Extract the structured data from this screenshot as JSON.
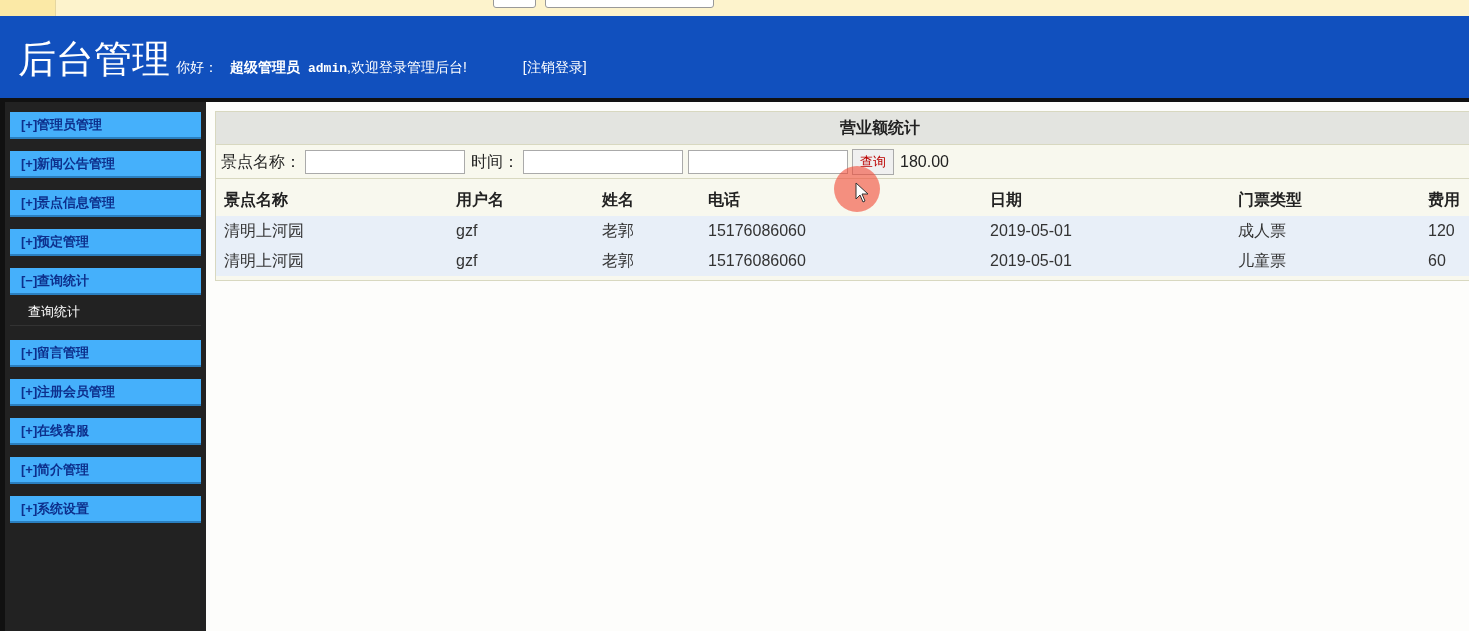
{
  "header": {
    "title": "后台管理",
    "greeting": "你好：",
    "role": "超级管理员",
    "username": "admin",
    "welcome": ",欢迎登录管理后台!",
    "logout": "[注销登录]"
  },
  "sidebar": {
    "items": [
      {
        "label": "[+]管理员管理"
      },
      {
        "label": "[+]新闻公告管理"
      },
      {
        "label": "[+]景点信息管理"
      },
      {
        "label": "[+]预定管理"
      },
      {
        "label": "[−]查询统计",
        "children": [
          {
            "label": "查询统计"
          }
        ]
      },
      {
        "label": "[+]留言管理"
      },
      {
        "label": "[+]注册会员管理"
      },
      {
        "label": "[+]在线客服"
      },
      {
        "label": "[+]简介管理"
      },
      {
        "label": "[+]系统设置"
      }
    ]
  },
  "panel": {
    "title": "营业额统计",
    "search": {
      "name_label": "景点名称：",
      "time_label": "时间：",
      "button": "查询",
      "total": "180.00"
    },
    "table": {
      "columns": [
        "景点名称",
        "用户名",
        "姓名",
        "电话",
        "日期",
        "门票类型",
        "费用"
      ],
      "rows": [
        [
          "清明上河园",
          "gzf",
          "老郭",
          "15176086060",
          "2019-05-01",
          "成人票",
          "120"
        ],
        [
          "清明上河园",
          "gzf",
          "老郭",
          "15176086060",
          "2019-05-01",
          "儿童票",
          "60"
        ]
      ]
    }
  }
}
